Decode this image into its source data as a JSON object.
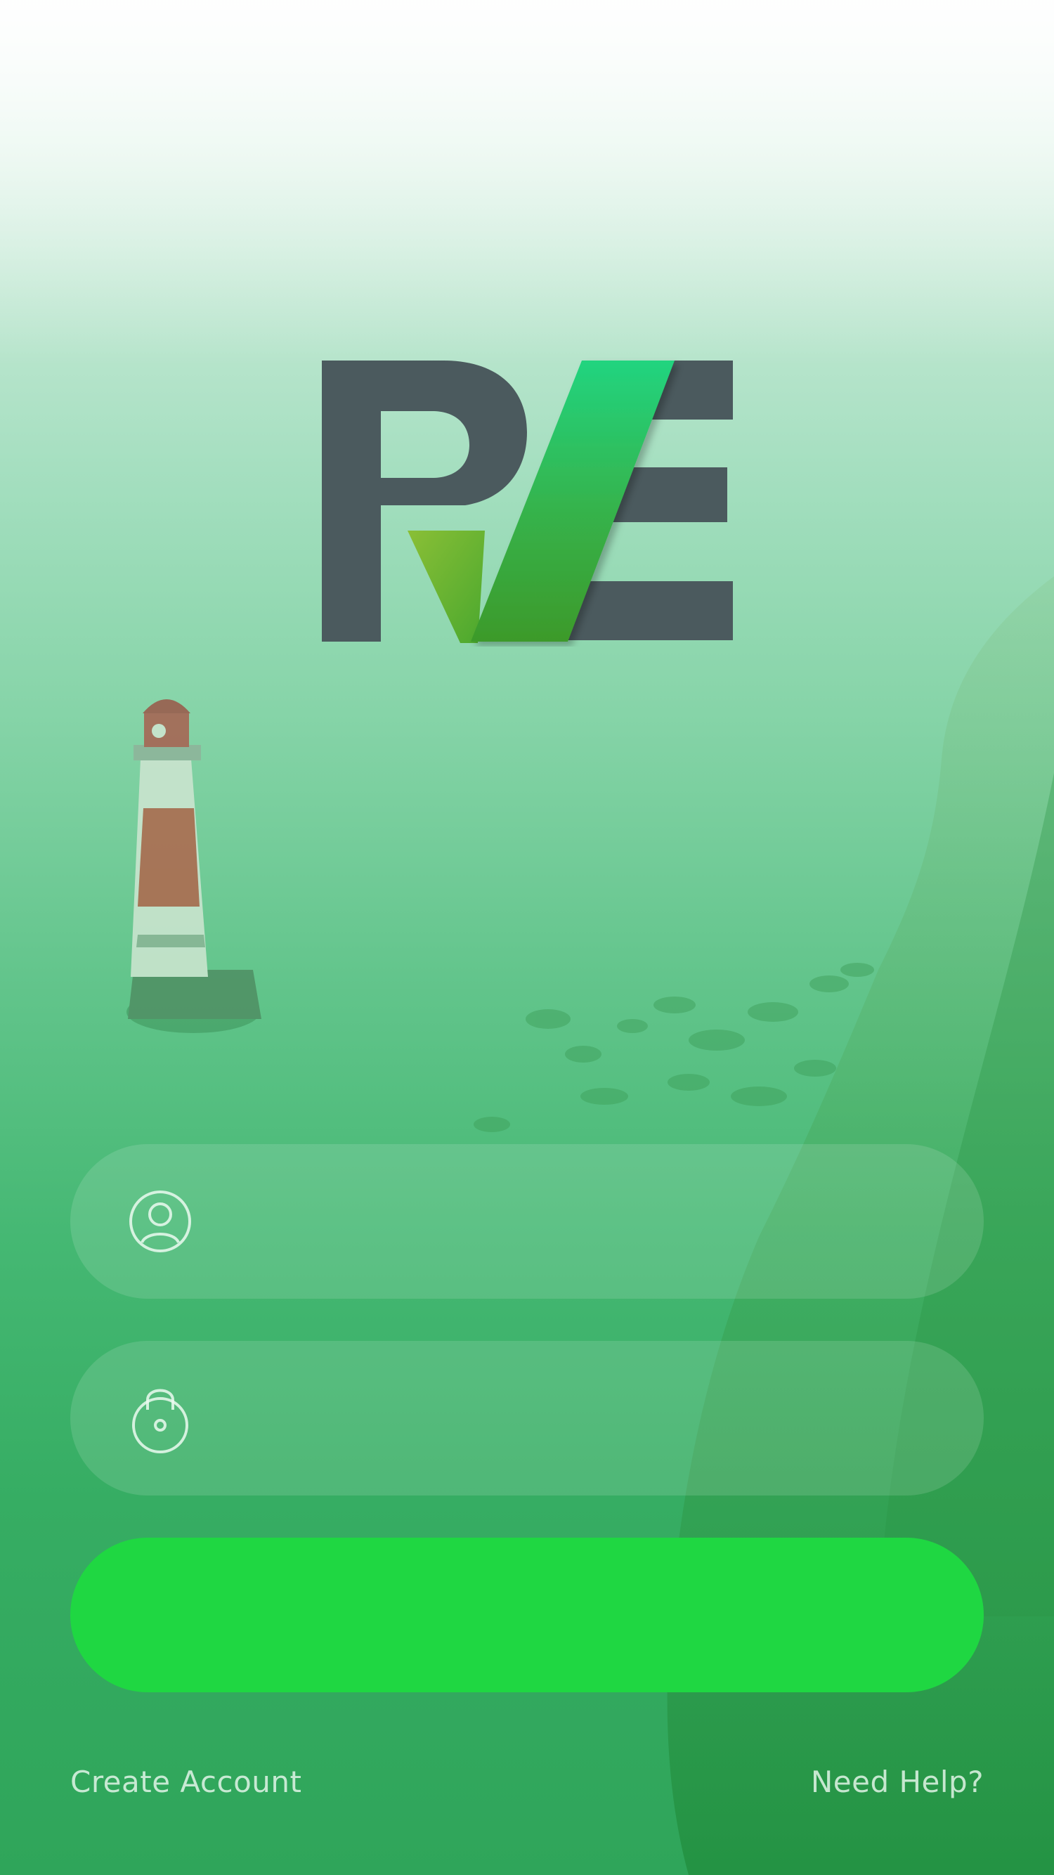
{
  "app": {
    "logo_text": "RVE"
  },
  "login": {
    "username_icon": "user-circle-icon",
    "username_placeholder": "",
    "password_icon": "lock-icon",
    "password_placeholder": "",
    "submit_label": ""
  },
  "footer": {
    "create_account": "Create Account",
    "need_help": "Need Help?"
  },
  "colors": {
    "primary_button": "#1fd742",
    "logo_dark": "#4b5a5e",
    "logo_green": "#2eb84c",
    "overlay_green": "#45b873"
  }
}
